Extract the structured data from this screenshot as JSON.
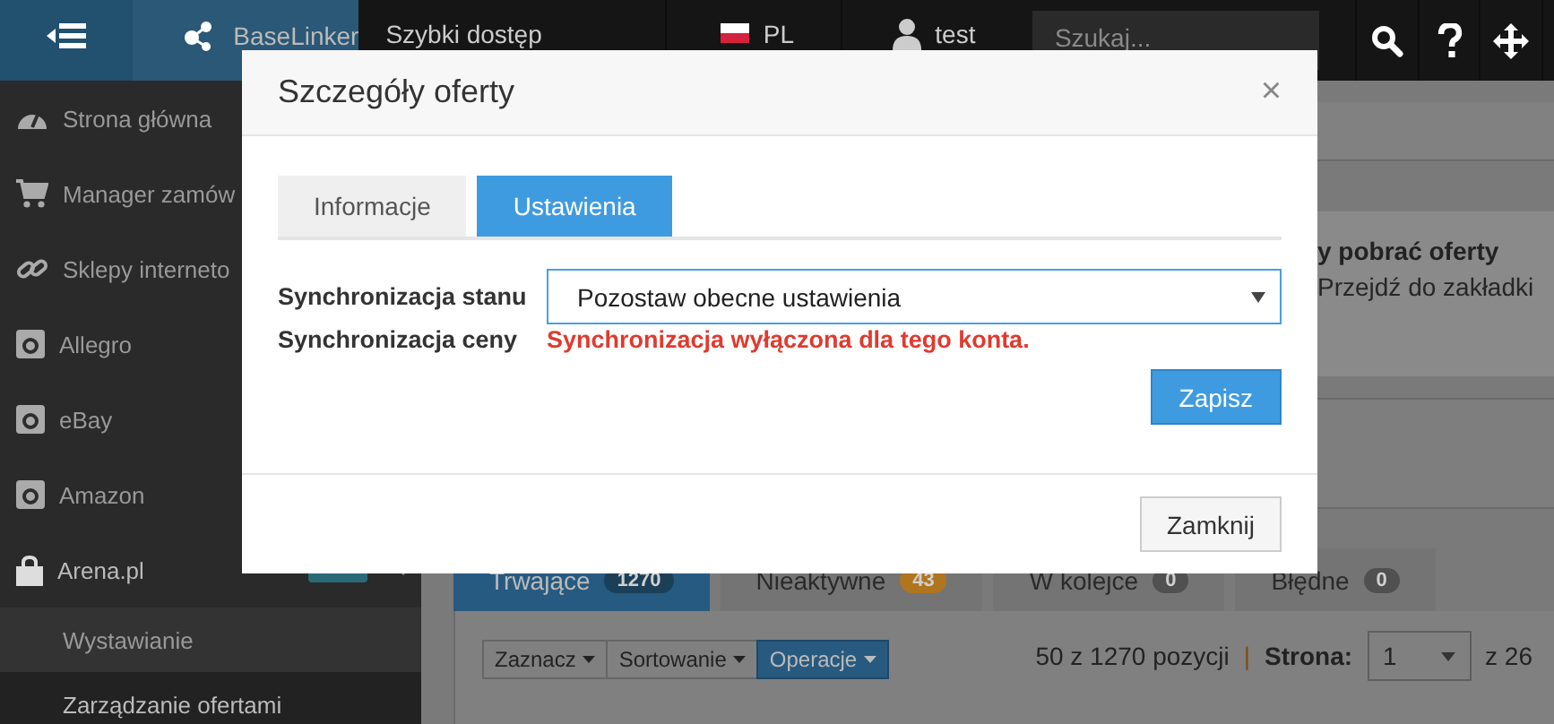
{
  "top_bar": {
    "brand": "BaseLinker",
    "quick_access": "Szybki dostęp",
    "language": "PL",
    "user": "test",
    "search": {
      "placeholder": "Szukaj..."
    }
  },
  "sidebar": {
    "items": [
      {
        "label": "Strona główna"
      },
      {
        "label": "Manager zamów"
      },
      {
        "label": "Sklepy interneto"
      },
      {
        "label": "Allegro"
      },
      {
        "label": "eBay"
      },
      {
        "label": "Amazon"
      },
      {
        "label": "Arena.pl",
        "expanded": true,
        "children": [
          {
            "label": "Wystawianie",
            "selected": false
          },
          {
            "label": "Zarządzanie ofertami",
            "selected": true
          }
        ]
      }
    ]
  },
  "content": {
    "alert": {
      "title": "y pobrać oferty",
      "text": "Przejdź do zakładki"
    },
    "tabs": [
      {
        "label": "Trwające",
        "count": "1270",
        "color": "#1c3f58",
        "selected": true
      },
      {
        "label": "Nieaktywne",
        "count": "43",
        "color": "#b0751f",
        "selected": false
      },
      {
        "label": "W kolejce",
        "count": "0",
        "color": "#505050",
        "selected": false
      },
      {
        "label": "Błędne",
        "count": "0",
        "color": "#505050",
        "selected": false
      }
    ],
    "toolbar": [
      {
        "label": "Zaznacz",
        "kind": "default"
      },
      {
        "label": "Sortowanie",
        "kind": "default"
      },
      {
        "label": "Operacje",
        "kind": "primary"
      }
    ],
    "pagination": {
      "summary": "50 z 1270 pozycji",
      "separator": "|",
      "page_label": "Strona:",
      "page": "1",
      "total": "z 26"
    }
  },
  "modal": {
    "title": "Szczegóły oferty",
    "close": "×",
    "tabs": [
      {
        "label": "Informacje",
        "selected": false
      },
      {
        "label": "Ustawienia",
        "selected": true
      }
    ],
    "fields": [
      {
        "label": "Synchronizacja stanu",
        "kind": "select",
        "value": "Pozostaw obecne ustawienia"
      },
      {
        "label": "Synchronizacja ceny",
        "kind": "message",
        "value": "Synchronizacja wyłączona dla tego konta."
      }
    ],
    "save_button": "Zapisz",
    "close_button": "Zamknij"
  }
}
